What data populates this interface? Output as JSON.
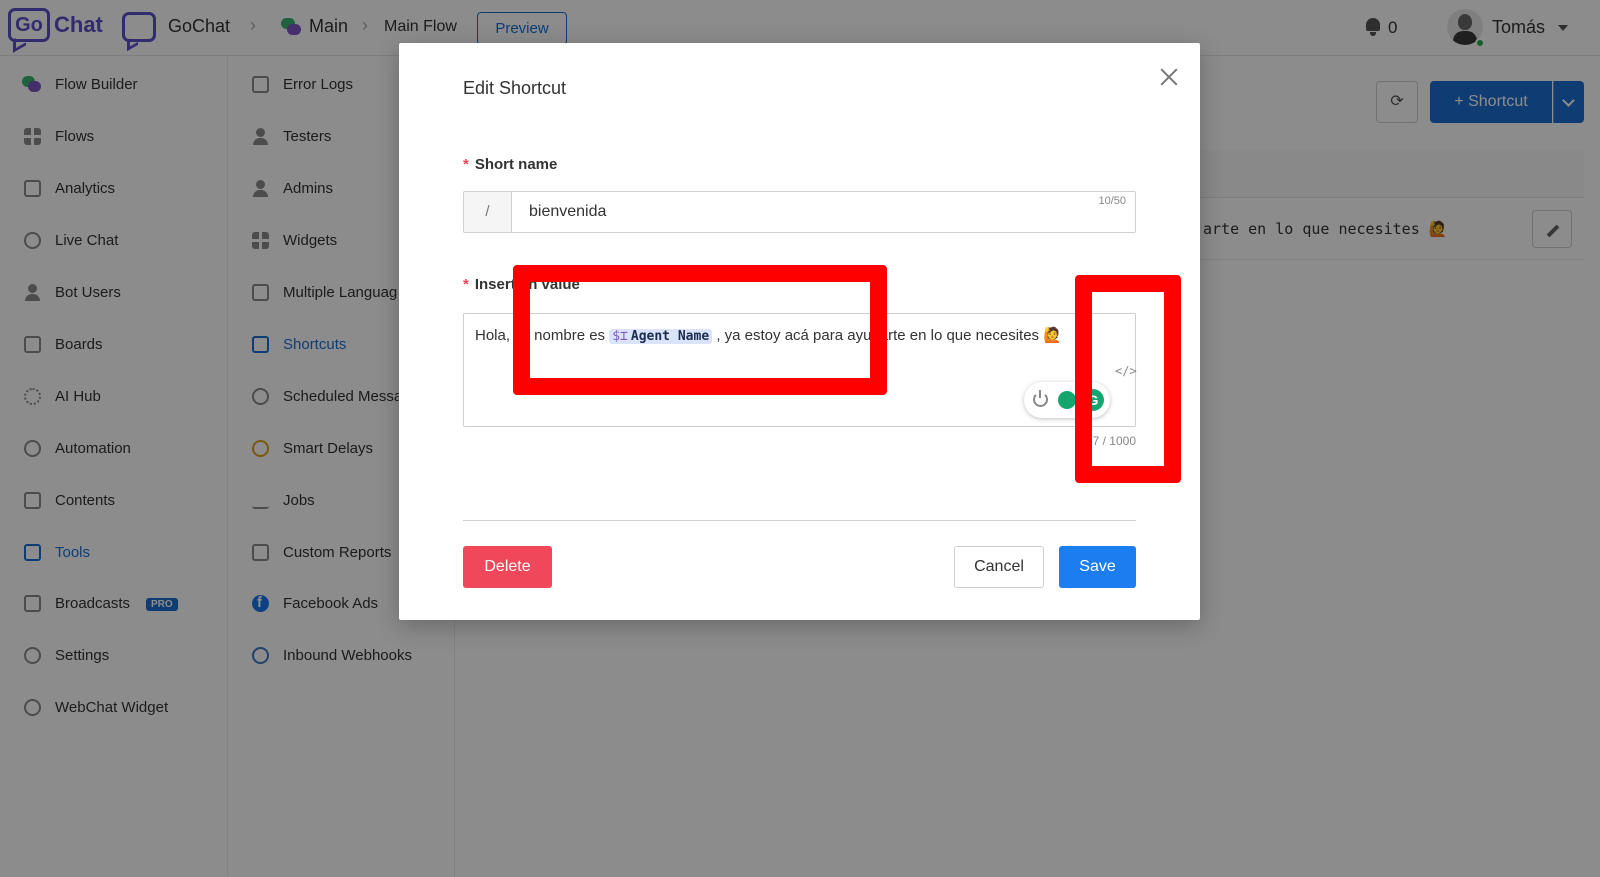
{
  "topbar": {
    "logo_go": "Go",
    "logo_chat": "Chat",
    "bot_name": "GoChat",
    "flow_folder": "Main",
    "flow_name": "Main Flow",
    "preview_label": "Preview",
    "notification_count": "0",
    "user_name": "Tomás"
  },
  "sidebar": {
    "items": [
      {
        "label": "Flow Builder",
        "icon": "chat-bubbles-icon"
      },
      {
        "label": "Flows",
        "icon": "grid-icon"
      },
      {
        "label": "Analytics",
        "icon": "chart-icon"
      },
      {
        "label": "Live Chat",
        "icon": "headset-icon"
      },
      {
        "label": "Bot Users",
        "icon": "user-icon"
      },
      {
        "label": "Boards",
        "icon": "board-icon"
      },
      {
        "label": "AI Hub",
        "icon": "sparkle-icon"
      },
      {
        "label": "Automation",
        "icon": "gear-icon"
      },
      {
        "label": "Contents",
        "icon": "contents-icon"
      },
      {
        "label": "Tools",
        "icon": "toolbox-icon"
      },
      {
        "label": "Broadcasts",
        "icon": "megaphone-icon",
        "badge": "PRO"
      },
      {
        "label": "Settings",
        "icon": "settings-icon"
      },
      {
        "label": "WebChat Widget",
        "icon": "webchat-icon"
      }
    ]
  },
  "tools_menu": {
    "items": [
      {
        "label": "Error Logs",
        "icon": "error-log-icon"
      },
      {
        "label": "Testers",
        "icon": "user-icon"
      },
      {
        "label": "Admins",
        "icon": "admin-icon"
      },
      {
        "label": "Widgets",
        "icon": "widgets-icon"
      },
      {
        "label": "Multiple Languag",
        "icon": "language-icon"
      },
      {
        "label": "Shortcuts",
        "icon": "document-icon"
      },
      {
        "label": "Scheduled Messa",
        "icon": "clock-icon"
      },
      {
        "label": "Smart Delays",
        "icon": "clock-orange-icon"
      },
      {
        "label": "Jobs",
        "icon": "download-icon"
      },
      {
        "label": "Custom Reports",
        "icon": "report-icon"
      },
      {
        "label": "Facebook Ads",
        "icon": "facebook-icon"
      },
      {
        "label": "Inbound Webhooks",
        "icon": "webhook-icon"
      }
    ]
  },
  "main": {
    "add_shortcut_label": "+ Shortcut",
    "row_text": "arte en lo que necesites 🙋"
  },
  "modal": {
    "title": "Edit Shortcut",
    "short_name_label": "Short name",
    "short_name_prefix": "/",
    "short_name_value": "bienvenida",
    "short_name_count": "10/50",
    "insert_value_label": "Insert an value",
    "value_before": "Hola, mi nombre es ",
    "value_variable": "Agent Name",
    "value_variable_icon": "$⌶",
    "value_after": " , ya estoy acá para ayudarte en lo que necesites 🙋",
    "value_count": "87 / 1000",
    "code_toggle": "</>",
    "grammarly_letter": "G",
    "delete_label": "Delete",
    "cancel_label": "Cancel",
    "save_label": "Save"
  },
  "colors": {
    "primary": "#1c6fd1",
    "danger": "#f0485a",
    "annotation": "#ff0000",
    "brand": "#5b4fc9"
  }
}
